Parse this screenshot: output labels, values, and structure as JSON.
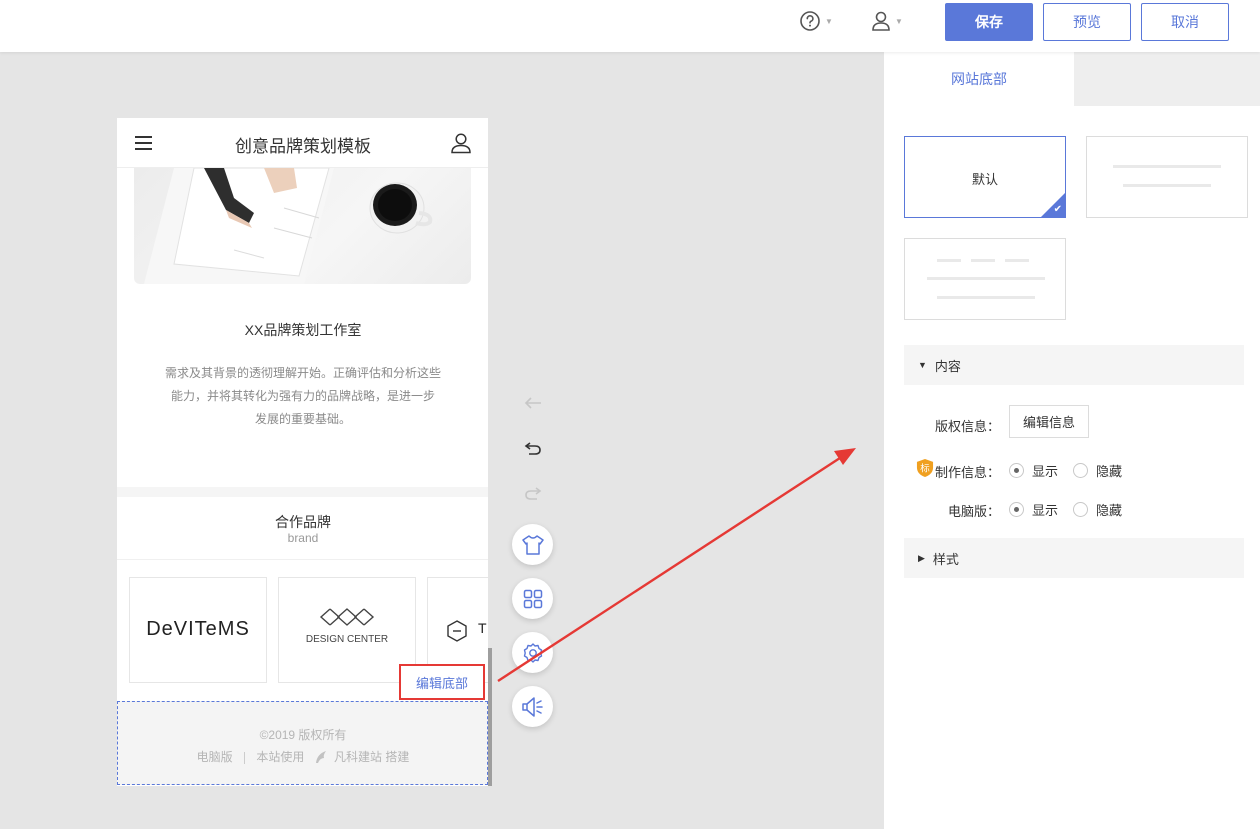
{
  "topbar": {
    "help_icon": "help-circle-icon",
    "user_icon": "user-icon",
    "save_label": "保存",
    "preview_label": "预览",
    "cancel_label": "取消"
  },
  "phone": {
    "title": "创意品牌策划模板",
    "studio_title": "XX品牌策划工作室",
    "studio_desc": [
      "需求及其背景的透彻理解开始。正确评估和分析这些",
      "能力，并将其转化为强有力的品牌战略，是进一步",
      "发展的重要基础。"
    ],
    "brand_title": "合作品牌",
    "brand_subtitle": "brand",
    "brands": [
      {
        "name": "DEVITEMS",
        "display": "DeVITeMS"
      },
      {
        "name": "DESIGN CENTER",
        "display": "DESIGN CENTER"
      },
      {
        "name": "third-brand",
        "display": "T"
      }
    ],
    "footer": {
      "copyright": "©2019 版权所有",
      "pc_link": "电脑版",
      "site_use": "本站使用",
      "builder": "凡科建站",
      "built": "搭建"
    },
    "edit_footer_label": "编辑底部"
  },
  "tools": {
    "history": [
      "back-arrow-icon",
      "undo-icon",
      "redo-icon"
    ],
    "buttons": [
      "shirt-icon",
      "grid-icon",
      "settings-gear-icon",
      "speaker-icon"
    ]
  },
  "panel": {
    "tab_label": "网站底部",
    "templates": [
      {
        "label": "默认",
        "selected": true
      },
      {
        "label": "",
        "selected": false
      },
      {
        "label": "",
        "selected": false
      }
    ],
    "content_section": "内容",
    "copyright_label": "版权信息：",
    "edit_info_label": "编辑信息",
    "production_label": "制作信息：",
    "badge_text": "标",
    "pc_label": "电脑版：",
    "show_label": "显示",
    "hide_label": "隐藏",
    "style_section": "样式"
  },
  "colors": {
    "accent": "#5a78d9",
    "annotation_red": "#e53935",
    "badge_orange": "#f0a020"
  }
}
